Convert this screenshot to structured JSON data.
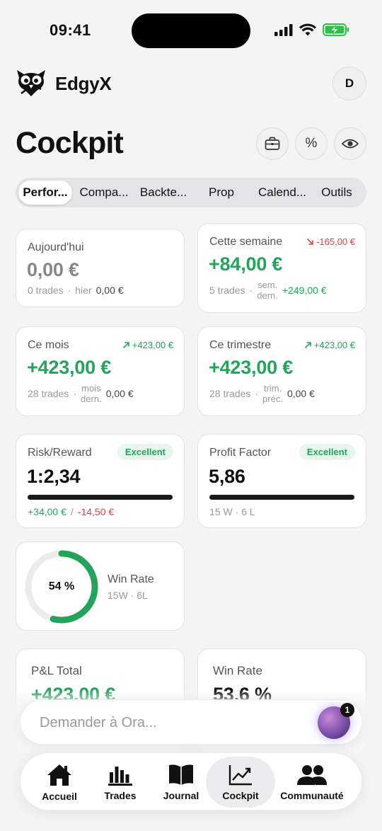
{
  "status_bar": {
    "time": "09:41"
  },
  "header": {
    "app_name": "EdgyX",
    "avatar_initial": "D"
  },
  "page": {
    "title": "Cockpit"
  },
  "title_actions": [
    {
      "icon": "briefcase-icon"
    },
    {
      "icon": "percent-icon",
      "glyph": "%"
    },
    {
      "icon": "eye-icon"
    }
  ],
  "tabs": [
    {
      "label": "Perfor...",
      "active": true
    },
    {
      "label": "Compa...",
      "active": false
    },
    {
      "label": "Backte...",
      "active": false
    },
    {
      "label": "Prop",
      "active": false
    },
    {
      "label": "Calend...",
      "active": false
    },
    {
      "label": "Outils",
      "active": false
    }
  ],
  "cards": {
    "today": {
      "label": "Aujourd'hui",
      "value": "0,00 €",
      "trades": "0 trades",
      "prev_label": "hier",
      "prev_value": "0,00 €"
    },
    "week": {
      "label": "Cette semaine",
      "delta": "-165,00 €",
      "value": "+84,00 €",
      "trades": "5 trades",
      "prev_label_1": "sem.",
      "prev_label_2": "dern.",
      "prev_value": "+249,00 €"
    },
    "month": {
      "label": "Ce mois",
      "delta": "+423,00 €",
      "value": "+423,00 €",
      "trades": "28 trades",
      "prev_label_1": "mois",
      "prev_label_2": "dern.",
      "prev_value": "0,00 €"
    },
    "quarter": {
      "label": "Ce trimestre",
      "delta": "+423,00 €",
      "value": "+423,00 €",
      "trades": "28 trades",
      "prev_label_1": "trim.",
      "prev_label_2": "préc.",
      "prev_value": "0,00 €"
    },
    "risk_reward": {
      "label": "Risk/Reward",
      "badge": "Excellent",
      "value": "1:2,34",
      "gain": "+34,00 €",
      "separator": "/",
      "loss": "-14,50 €"
    },
    "profit_factor": {
      "label": "Profit Factor",
      "badge": "Excellent",
      "value": "5,86",
      "detail": "15 W · 6 L"
    },
    "win_rate_ring": {
      "percent_label": "54 %",
      "percent": 0.54,
      "label": "Win Rate",
      "detail": "15W · 6L"
    },
    "pnl_total": {
      "label": "P&L Total",
      "value": "+423,00 €"
    },
    "win_rate": {
      "label": "Win Rate",
      "value": "53,6 %"
    }
  },
  "ask_ora": {
    "placeholder": "Demander à Ora...",
    "badge_count": "1"
  },
  "bottom_nav": [
    {
      "label": "Accueil",
      "icon": "home-icon",
      "active": false
    },
    {
      "label": "Trades",
      "icon": "bar-chart-icon",
      "active": false
    },
    {
      "label": "Journal",
      "icon": "book-icon",
      "active": false
    },
    {
      "label": "Cockpit",
      "icon": "trend-chart-icon",
      "active": true
    },
    {
      "label": "Communauté",
      "icon": "users-icon",
      "active": false
    }
  ],
  "colors": {
    "positive": "#22a55a",
    "negative": "#e2433c",
    "background": "#f4f4f5"
  }
}
